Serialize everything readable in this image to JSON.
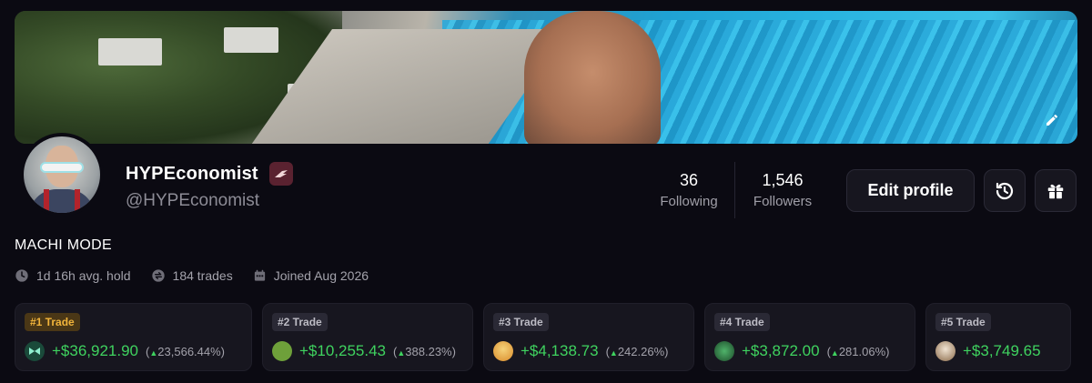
{
  "profile": {
    "display_name": "HYPEconomist",
    "handle": "@HYPEconomist",
    "bio": "MACHI MODE",
    "badge_icon": "wing-badge-icon"
  },
  "stats": {
    "following_count": "36",
    "following_label": "Following",
    "followers_count": "1,546",
    "followers_label": "Followers"
  },
  "actions": {
    "edit_profile_label": "Edit profile",
    "history_icon": "history-icon",
    "gift_icon": "gift-icon",
    "banner_edit_icon": "pencil-icon"
  },
  "meta": {
    "avg_hold": "1d 16h avg. hold",
    "trades": "184 trades",
    "joined": "Joined Aug 2026"
  },
  "top_trades": [
    {
      "rank": "#1 Trade",
      "pnl": "+$36,921.90",
      "pct": "23,566.44%)",
      "token_color": "#1a4a3a"
    },
    {
      "rank": "#2 Trade",
      "pnl": "+$10,255.43",
      "pct": "388.23%)",
      "token_color": "#6ea03a"
    },
    {
      "rank": "#3 Trade",
      "pnl": "+$4,138.73",
      "pct": "242.26%)",
      "token_color": "#e8b23a"
    },
    {
      "rank": "#4 Trade",
      "pnl": "+$3,872.00",
      "pct": "281.06%)",
      "token_color": "#2e7a3a"
    },
    {
      "rank": "#5 Trade",
      "pnl": "+$3,749.65",
      "pct": "",
      "token_color": "#c9a07a"
    }
  ],
  "colors": {
    "background": "#0b0a12",
    "positive": "#3fd35f",
    "rank_gold": "#f1b43b"
  }
}
